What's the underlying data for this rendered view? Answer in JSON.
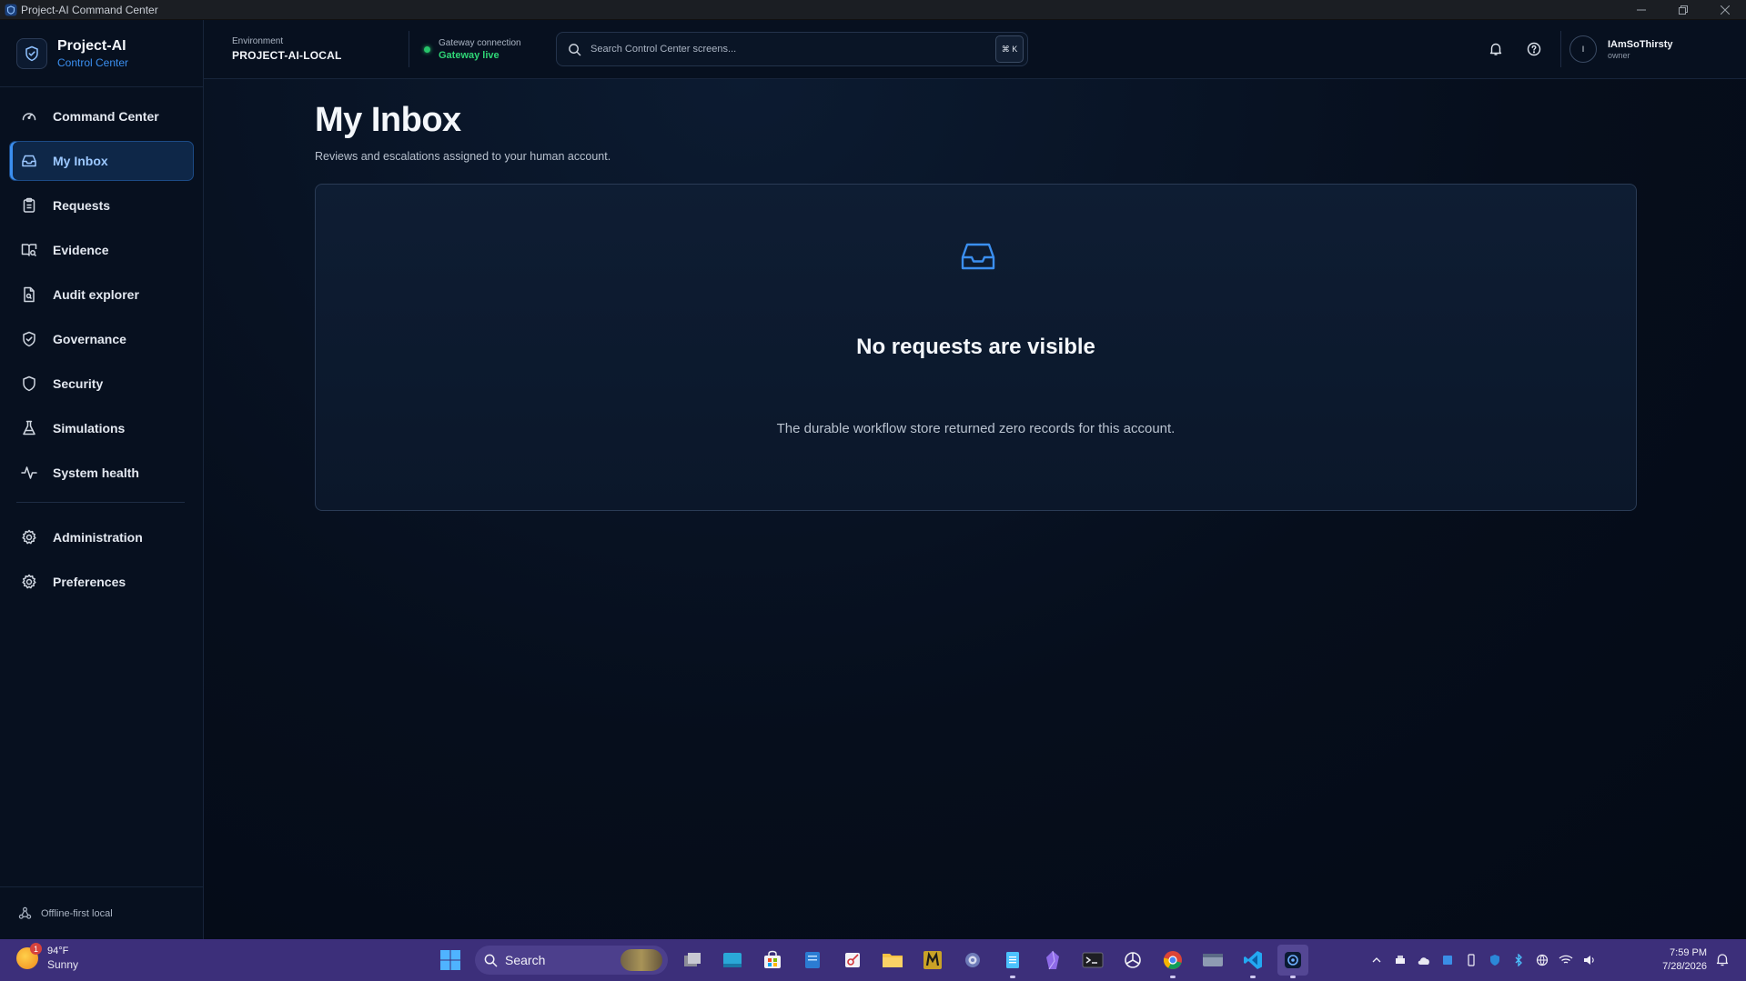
{
  "window": {
    "title": "Project-AI Command Center"
  },
  "brand": {
    "name": "Project-AI",
    "subtitle": "Control Center"
  },
  "sidebar": {
    "items": [
      {
        "label": "Command Center",
        "icon": "gauge-icon",
        "active": false
      },
      {
        "label": "My Inbox",
        "icon": "inbox-icon",
        "active": true
      },
      {
        "label": "Requests",
        "icon": "clipboard-icon",
        "active": false
      },
      {
        "label": "Evidence",
        "icon": "book-search-icon",
        "active": false
      },
      {
        "label": "Audit explorer",
        "icon": "file-search-icon",
        "active": false
      },
      {
        "label": "Governance",
        "icon": "shield-check-icon",
        "active": false
      },
      {
        "label": "Security",
        "icon": "shield-icon",
        "active": false
      },
      {
        "label": "Simulations",
        "icon": "flask-icon",
        "active": false
      },
      {
        "label": "System health",
        "icon": "activity-icon",
        "active": false
      }
    ],
    "secondary_items": [
      {
        "label": "Administration",
        "icon": "gear-icon"
      },
      {
        "label": "Preferences",
        "icon": "gear-icon"
      }
    ],
    "footer_label": "Offline-first local"
  },
  "header": {
    "environment_label": "Environment",
    "environment_value": "PROJECT-AI-LOCAL",
    "gateway_label": "Gateway connection",
    "gateway_status": "Gateway live",
    "search_placeholder": "Search Control Center screens...",
    "search_shortcut": "⌘ K",
    "user": {
      "initial": "I",
      "name": "IAmSoThirsty",
      "role": "owner"
    }
  },
  "main": {
    "title": "My Inbox",
    "subtitle": "Reviews and escalations assigned to your human account.",
    "empty_state": {
      "title": "No requests are visible",
      "message": "The durable workflow store returned zero records for this account."
    }
  },
  "taskbar": {
    "weather": {
      "temp": "94°F",
      "condition": "Sunny",
      "badge": "1"
    },
    "search_label": "Search",
    "clock": {
      "time": "7:59 PM",
      "date": "7/28/2026"
    }
  },
  "colors": {
    "accent": "#3b8ff0",
    "live": "#2fd576",
    "background": "#050b16",
    "taskbar": "#3c2f7a"
  }
}
